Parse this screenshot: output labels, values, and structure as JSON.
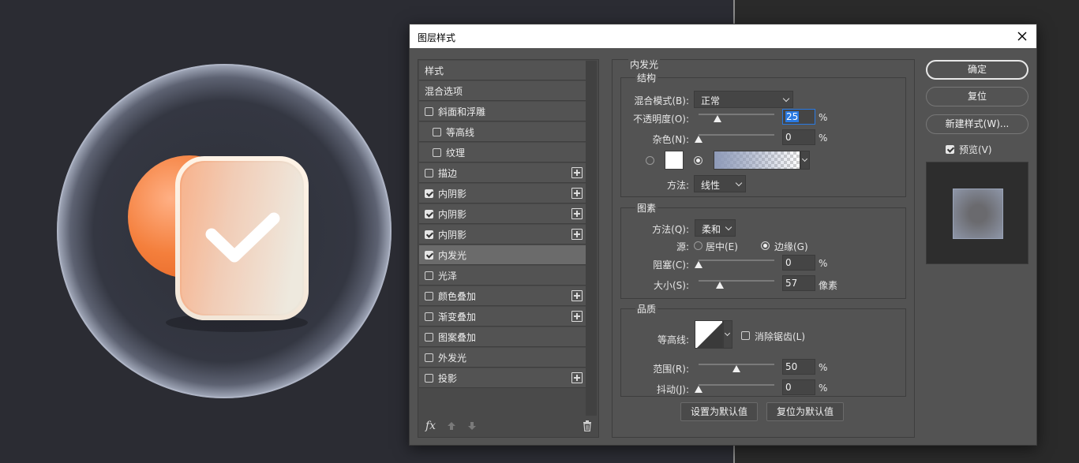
{
  "dialog": {
    "title": "图层样式"
  },
  "style_list": [
    {
      "label": "样式",
      "checkbox": false,
      "checked": false,
      "plus": false,
      "indent": 0
    },
    {
      "label": "混合选项",
      "checkbox": false,
      "checked": false,
      "plus": false,
      "indent": 0
    },
    {
      "label": "斜面和浮雕",
      "checkbox": true,
      "checked": false,
      "plus": false,
      "indent": 0
    },
    {
      "label": "等高线",
      "checkbox": true,
      "checked": false,
      "plus": false,
      "indent": 1
    },
    {
      "label": "纹理",
      "checkbox": true,
      "checked": false,
      "plus": false,
      "indent": 1
    },
    {
      "label": "描边",
      "checkbox": true,
      "checked": false,
      "plus": true,
      "indent": 0
    },
    {
      "label": "内阴影",
      "checkbox": true,
      "checked": true,
      "plus": true,
      "indent": 0
    },
    {
      "label": "内阴影",
      "checkbox": true,
      "checked": true,
      "plus": true,
      "indent": 0
    },
    {
      "label": "内阴影",
      "checkbox": true,
      "checked": true,
      "plus": true,
      "indent": 0
    },
    {
      "label": "内发光",
      "checkbox": true,
      "checked": true,
      "plus": false,
      "indent": 0,
      "selected": true
    },
    {
      "label": "光泽",
      "checkbox": true,
      "checked": false,
      "plus": false,
      "indent": 0
    },
    {
      "label": "颜色叠加",
      "checkbox": true,
      "checked": false,
      "plus": true,
      "indent": 0
    },
    {
      "label": "渐变叠加",
      "checkbox": true,
      "checked": false,
      "plus": true,
      "indent": 0
    },
    {
      "label": "图案叠加",
      "checkbox": true,
      "checked": false,
      "plus": false,
      "indent": 0
    },
    {
      "label": "外发光",
      "checkbox": true,
      "checked": false,
      "plus": false,
      "indent": 0
    },
    {
      "label": "投影",
      "checkbox": true,
      "checked": false,
      "plus": true,
      "indent": 0
    }
  ],
  "list_footer": {
    "fx": "fx"
  },
  "inner_glow": {
    "title": "内发光",
    "structure": {
      "title": "结构",
      "blend_mode_label": "混合模式(B):",
      "blend_mode_value": "正常",
      "opacity_label": "不透明度(O):",
      "opacity_value": "25",
      "opacity_unit": "%",
      "opacity_level": 25,
      "noise_label": "杂色(N):",
      "noise_value": "0",
      "noise_unit": "%",
      "noise_level": 0,
      "color_hex": "#ffffff",
      "method_label": "方法:",
      "method_value": "线性"
    },
    "elements": {
      "title": "图素",
      "technique_label": "方法(Q):",
      "technique_value": "柔和",
      "source_label": "源:",
      "source_center": "居中(E)",
      "source_edge": "边缘(G)",
      "choke_label": "阻塞(C):",
      "choke_value": "0",
      "choke_unit": "%",
      "choke_level": 0,
      "size_label": "大小(S):",
      "size_value": "57",
      "size_unit": "像素",
      "size_level": 0.23
    },
    "quality": {
      "title": "品质",
      "contour_label": "等高线:",
      "anti_alias_label": "消除锯齿(L)",
      "range_label": "范围(R):",
      "range_value": "50",
      "range_unit": "%",
      "range_level": 50,
      "jitter_label": "抖动(J):",
      "jitter_value": "0",
      "jitter_unit": "%",
      "jitter_level": 0
    },
    "make_default": "设置为默认值",
    "reset_default": "复位为默认值"
  },
  "right": {
    "ok": "确定",
    "reset": "复位",
    "new_style": "新建样式(W)...",
    "preview_label": "预览(V)",
    "preview_checked": true
  },
  "colors": {
    "dialog_bg": "#535353",
    "canvas_bg": "#2b2c33",
    "orange_circle": "#f08a4b",
    "focus_blue": "#2a7ae2"
  }
}
